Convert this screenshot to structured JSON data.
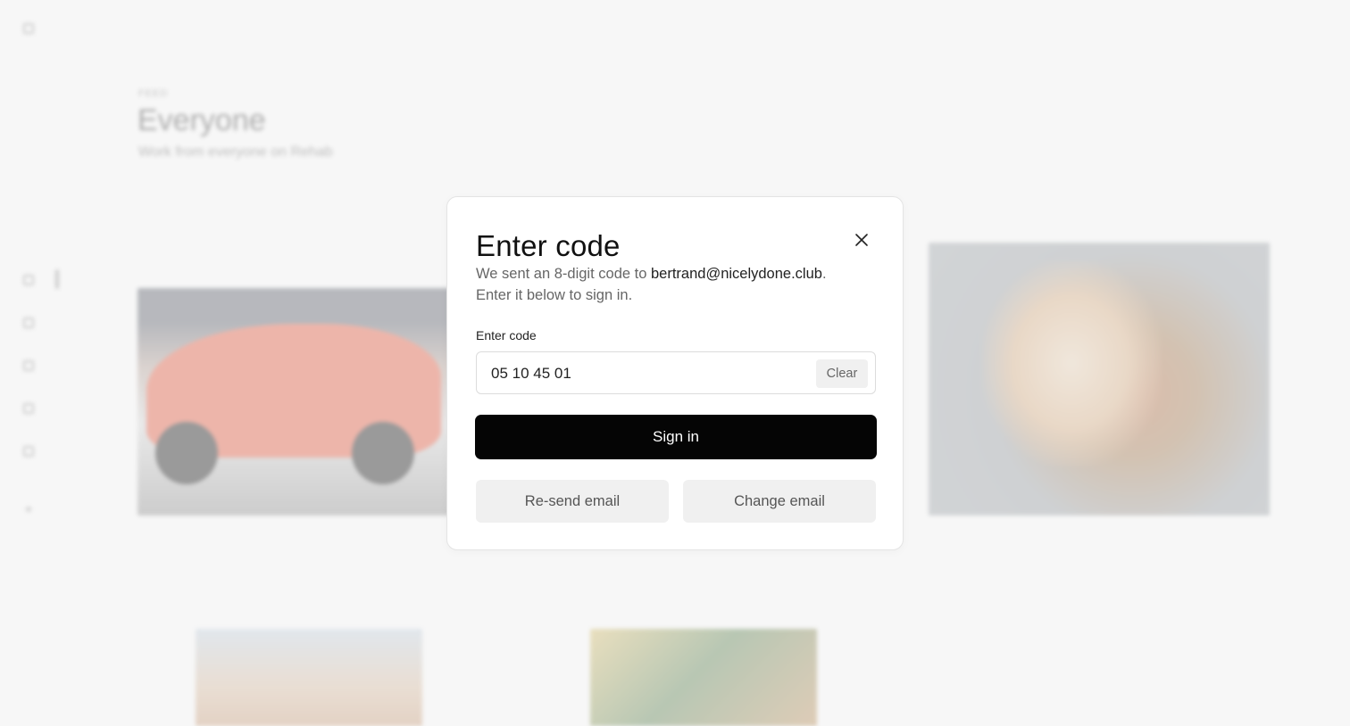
{
  "background": {
    "eyebrow": "FEED",
    "title": "Everyone",
    "subtitle": "Work from everyone on Rehab"
  },
  "modal": {
    "title": "Enter code",
    "description_prefix": "We sent an 8-digit code to ",
    "email": "bertrand@nicelydone.club",
    "description_suffix": ".",
    "description_line2": "Enter it below to sign in.",
    "code_label": "Enter code",
    "code_value": "05 10 45 01",
    "clear_label": "Clear",
    "signin_label": "Sign in",
    "resend_label": "Re-send email",
    "change_label": "Change email",
    "close_icon": "close-icon"
  },
  "colors": {
    "primary_button": "#050505",
    "secondary_button": "#f0f0f0",
    "page_background": "#f7f7f7"
  }
}
